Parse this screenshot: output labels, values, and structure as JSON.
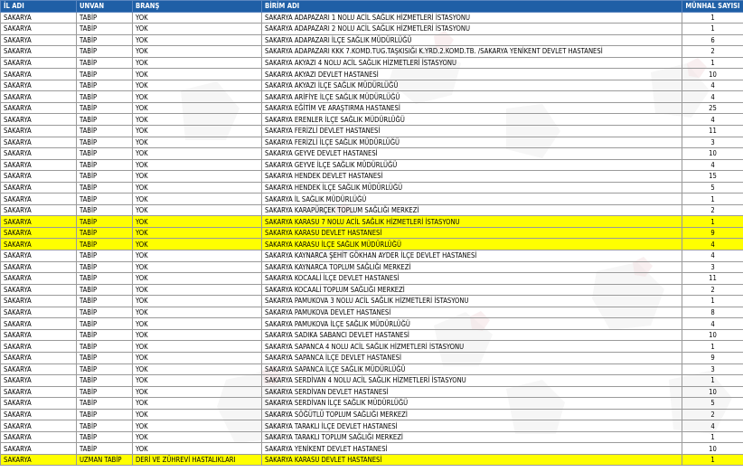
{
  "columns": [
    "İL ADI",
    "UNVAN",
    "BRANŞ",
    "BİRİM ADI",
    "MÜNHAL SAYISI"
  ],
  "highlight_color": "#ffff00",
  "header_color": "#1f5fa6",
  "rows": [
    {
      "il": "SAKARYA",
      "unvan": "TABİP",
      "brans": "YOK",
      "birim": "SAKARYA ADAPAZARI 1 NOLU ACİL SAĞLIK HİZMETLERİ İSTASYONU",
      "sayi": "1",
      "hl": false
    },
    {
      "il": "SAKARYA",
      "unvan": "TABİP",
      "brans": "YOK",
      "birim": "SAKARYA ADAPAZARI 2 NOLU ACİL SAĞLIK HİZMETLERİ İSTASYONU",
      "sayi": "1",
      "hl": false
    },
    {
      "il": "SAKARYA",
      "unvan": "TABİP",
      "brans": "YOK",
      "birim": "SAKARYA ADAPAZARI İLÇE SAĞLIK MÜDÜRLÜĞÜ",
      "sayi": "6",
      "hl": false
    },
    {
      "il": "SAKARYA",
      "unvan": "TABİP",
      "brans": "YOK",
      "birim": "SAKARYA ADAPAZARI KKK 7.KOMD.TUG.TAŞKISIĞI K.YRD.2.KOMD.TB. /SAKARYA YENİKENT DEVLET HASTANESİ",
      "sayi": "2",
      "hl": false
    },
    {
      "il": "SAKARYA",
      "unvan": "TABİP",
      "brans": "YOK",
      "birim": "SAKARYA AKYAZI 4 NOLU ACİL SAĞLIK HİZMETLERİ İSTASYONU",
      "sayi": "1",
      "hl": false
    },
    {
      "il": "SAKARYA",
      "unvan": "TABİP",
      "brans": "YOK",
      "birim": "SAKARYA AKYAZI DEVLET HASTANESİ",
      "sayi": "10",
      "hl": false
    },
    {
      "il": "SAKARYA",
      "unvan": "TABİP",
      "brans": "YOK",
      "birim": "SAKARYA AKYAZI İLÇE SAĞLIK MÜDÜRLÜĞÜ",
      "sayi": "4",
      "hl": false
    },
    {
      "il": "SAKARYA",
      "unvan": "TABİP",
      "brans": "YOK",
      "birim": "SAKARYA ARİFİYE İLÇE SAĞLIK MÜDÜRLÜĞÜ",
      "sayi": "4",
      "hl": false
    },
    {
      "il": "SAKARYA",
      "unvan": "TABİP",
      "brans": "YOK",
      "birim": "SAKARYA EĞİTİM VE ARAŞTIRMA HASTANESİ",
      "sayi": "25",
      "hl": false
    },
    {
      "il": "SAKARYA",
      "unvan": "TABİP",
      "brans": "YOK",
      "birim": "SAKARYA ERENLER İLÇE SAĞLIK MÜDÜRLÜĞÜ",
      "sayi": "4",
      "hl": false
    },
    {
      "il": "SAKARYA",
      "unvan": "TABİP",
      "brans": "YOK",
      "birim": "SAKARYA FERİZLİ DEVLET HASTANESİ",
      "sayi": "11",
      "hl": false
    },
    {
      "il": "SAKARYA",
      "unvan": "TABİP",
      "brans": "YOK",
      "birim": "SAKARYA FERİZLİ İLÇE SAĞLIK MÜDÜRLÜĞÜ",
      "sayi": "3",
      "hl": false
    },
    {
      "il": "SAKARYA",
      "unvan": "TABİP",
      "brans": "YOK",
      "birim": "SAKARYA GEYVE DEVLET HASTANESİ",
      "sayi": "10",
      "hl": false
    },
    {
      "il": "SAKARYA",
      "unvan": "TABİP",
      "brans": "YOK",
      "birim": "SAKARYA GEYVE İLÇE SAĞLIK MÜDÜRLÜĞÜ",
      "sayi": "4",
      "hl": false
    },
    {
      "il": "SAKARYA",
      "unvan": "TABİP",
      "brans": "YOK",
      "birim": "SAKARYA HENDEK DEVLET HASTANESİ",
      "sayi": "15",
      "hl": false
    },
    {
      "il": "SAKARYA",
      "unvan": "TABİP",
      "brans": "YOK",
      "birim": "SAKARYA HENDEK İLÇE SAĞLIK MÜDÜRLÜĞÜ",
      "sayi": "5",
      "hl": false
    },
    {
      "il": "SAKARYA",
      "unvan": "TABİP",
      "brans": "YOK",
      "birim": "SAKARYA İL SAĞLIK MÜDÜRLÜĞÜ",
      "sayi": "1",
      "hl": false
    },
    {
      "il": "SAKARYA",
      "unvan": "TABİP",
      "brans": "YOK",
      "birim": "SAKARYA KARAPÜRÇEK TOPLUM SAĞLIĞI MERKEZİ",
      "sayi": "2",
      "hl": false
    },
    {
      "il": "SAKARYA",
      "unvan": "TABİP",
      "brans": "YOK",
      "birim": "SAKARYA KARASU 7 NOLU ACİL SAĞLIK HİZMETLERİ İSTASYONU",
      "sayi": "1",
      "hl": true
    },
    {
      "il": "SAKARYA",
      "unvan": "TABİP",
      "brans": "YOK",
      "birim": "SAKARYA KARASU DEVLET HASTANESİ",
      "sayi": "9",
      "hl": true
    },
    {
      "il": "SAKARYA",
      "unvan": "TABİP",
      "brans": "YOK",
      "birim": "SAKARYA KARASU İLÇE SAĞLIK MÜDÜRLÜĞÜ",
      "sayi": "4",
      "hl": true
    },
    {
      "il": "SAKARYA",
      "unvan": "TABİP",
      "brans": "YOK",
      "birim": "SAKARYA KAYNARCA ŞEHİT GÖKHAN AYDER İLÇE DEVLET HASTANESİ",
      "sayi": "4",
      "hl": false
    },
    {
      "il": "SAKARYA",
      "unvan": "TABİP",
      "brans": "YOK",
      "birim": "SAKARYA KAYNARCA TOPLUM SAĞLIĞI MERKEZİ",
      "sayi": "3",
      "hl": false
    },
    {
      "il": "SAKARYA",
      "unvan": "TABİP",
      "brans": "YOK",
      "birim": "SAKARYA KOCAALİ İLÇE DEVLET HASTANESİ",
      "sayi": "11",
      "hl": false
    },
    {
      "il": "SAKARYA",
      "unvan": "TABİP",
      "brans": "YOK",
      "birim": "SAKARYA KOCAALİ TOPLUM SAĞLIĞI MERKEZİ",
      "sayi": "2",
      "hl": false
    },
    {
      "il": "SAKARYA",
      "unvan": "TABİP",
      "brans": "YOK",
      "birim": "SAKARYA PAMUKOVA 3 NOLU ACİL SAĞLIK HİZMETLERİ İSTASYONU",
      "sayi": "1",
      "hl": false
    },
    {
      "il": "SAKARYA",
      "unvan": "TABİP",
      "brans": "YOK",
      "birim": "SAKARYA PAMUKOVA DEVLET HASTANESİ",
      "sayi": "8",
      "hl": false
    },
    {
      "il": "SAKARYA",
      "unvan": "TABİP",
      "brans": "YOK",
      "birim": "SAKARYA PAMUKOVA İLÇE SAĞLIK MÜDÜRLÜĞÜ",
      "sayi": "4",
      "hl": false
    },
    {
      "il": "SAKARYA",
      "unvan": "TABİP",
      "brans": "YOK",
      "birim": "SAKARYA SADIKA SABANCI DEVLET HASTANESİ",
      "sayi": "10",
      "hl": false
    },
    {
      "il": "SAKARYA",
      "unvan": "TABİP",
      "brans": "YOK",
      "birim": "SAKARYA SAPANCA 4 NOLU ACİL SAĞLIK HİZMETLERİ İSTASYONU",
      "sayi": "1",
      "hl": false
    },
    {
      "il": "SAKARYA",
      "unvan": "TABİP",
      "brans": "YOK",
      "birim": "SAKARYA SAPANCA İLÇE DEVLET HASTANESİ",
      "sayi": "9",
      "hl": false
    },
    {
      "il": "SAKARYA",
      "unvan": "TABİP",
      "brans": "YOK",
      "birim": "SAKARYA SAPANCA İLÇE SAĞLIK MÜDÜRLÜĞÜ",
      "sayi": "3",
      "hl": false
    },
    {
      "il": "SAKARYA",
      "unvan": "TABİP",
      "brans": "YOK",
      "birim": "SAKARYA SERDİVAN 4 NOLU ACİL SAĞLIK HİZMETLERİ İSTASYONU",
      "sayi": "1",
      "hl": false
    },
    {
      "il": "SAKARYA",
      "unvan": "TABİP",
      "brans": "YOK",
      "birim": "SAKARYA SERDİVAN DEVLET HASTANESİ",
      "sayi": "10",
      "hl": false
    },
    {
      "il": "SAKARYA",
      "unvan": "TABİP",
      "brans": "YOK",
      "birim": "SAKARYA SERDİVAN İLÇE SAĞLIK MÜDÜRLÜĞÜ",
      "sayi": "5",
      "hl": false
    },
    {
      "il": "SAKARYA",
      "unvan": "TABİP",
      "brans": "YOK",
      "birim": "SAKARYA SÖĞÜTLÜ TOPLUM SAĞLIĞI MERKEZİ",
      "sayi": "2",
      "hl": false
    },
    {
      "il": "SAKARYA",
      "unvan": "TABİP",
      "brans": "YOK",
      "birim": "SAKARYA TARAKLI İLÇE DEVLET HASTANESİ",
      "sayi": "4",
      "hl": false
    },
    {
      "il": "SAKARYA",
      "unvan": "TABİP",
      "brans": "YOK",
      "birim": "SAKARYA TARAKLI TOPLUM SAĞLIĞI MERKEZİ",
      "sayi": "1",
      "hl": false
    },
    {
      "il": "SAKARYA",
      "unvan": "TABİP",
      "brans": "YOK",
      "birim": "SAKARYA YENİKENT DEVLET HASTANESİ",
      "sayi": "10",
      "hl": false
    },
    {
      "il": "SAKARYA",
      "unvan": "UZMAN TABİP",
      "brans": "DERİ VE ZÜHREVİ HASTALIKLARI",
      "birim": "SAKARYA KARASU DEVLET HASTANESİ",
      "sayi": "1",
      "hl": true
    }
  ]
}
